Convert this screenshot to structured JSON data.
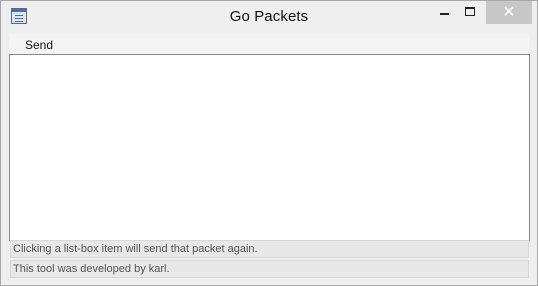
{
  "window": {
    "title": "Go Packets",
    "close_glyph": "✕",
    "icons": {
      "app": "application-icon",
      "minimize": "minimize-icon",
      "maximize": "maximize-icon",
      "close": "close-icon"
    }
  },
  "menubar": {
    "items": [
      {
        "label": "Send"
      }
    ]
  },
  "listbox": {
    "items": []
  },
  "status": {
    "line1": "Clicking a list-box item will send that packet again.",
    "line2": "This tool was developed by karl."
  }
}
